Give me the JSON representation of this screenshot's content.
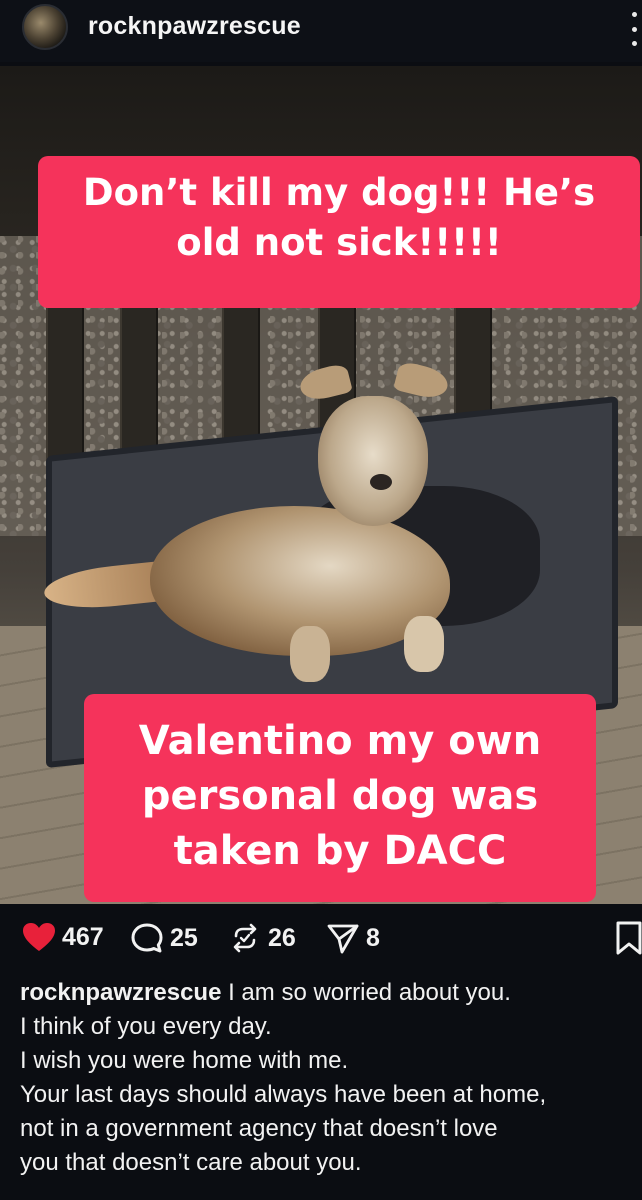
{
  "header": {
    "username": "rocknpawzrescue"
  },
  "post": {
    "overlay_top": [
      "Don’t kill my dog!!! He’s",
      "old not sick!!!!!"
    ],
    "overlay_bottom": [
      "Valentino my own",
      "personal dog was",
      "taken by DACC"
    ]
  },
  "actions": {
    "likes": "467",
    "comments": "25",
    "reposts": "26",
    "shares": "8",
    "heart_color": "#e8213a"
  },
  "caption": {
    "username": "rocknpawzrescue",
    "lines": [
      "I am so worried about you.",
      "I think of you every day.",
      "I wish you were home with me.",
      "Your last days should always have been at home,",
      "not in a government agency that doesn’t love",
      "you that doesn’t care about you."
    ]
  }
}
